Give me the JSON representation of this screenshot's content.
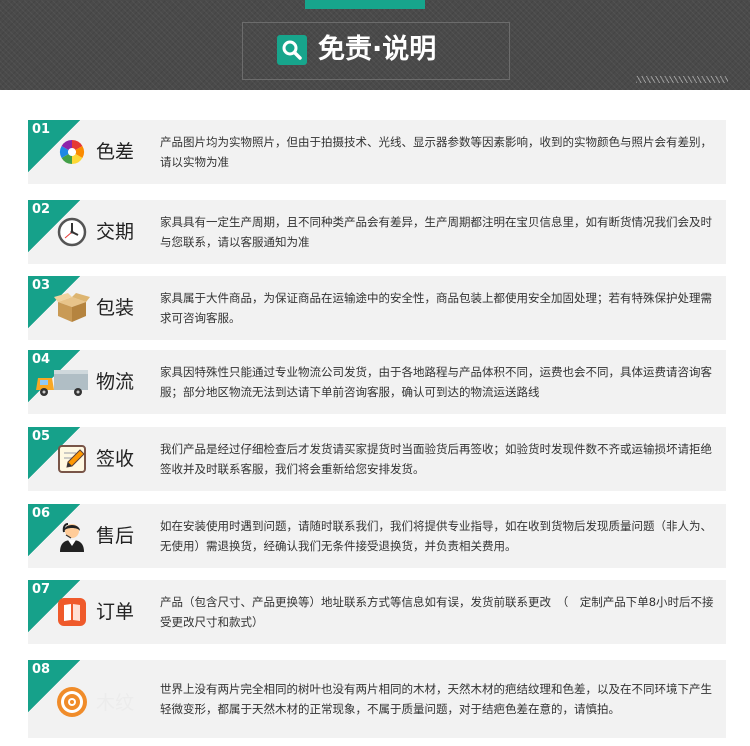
{
  "header": {
    "title": "免责·说明",
    "accent_color": "#17a58c",
    "icon": "search-icon"
  },
  "items": [
    {
      "num": "01",
      "label": "色差",
      "icon": "color-wheel-icon",
      "desc": "产品图片均为实物照片，但由于拍摄技术、光线、显示器参数等因素影响，收到的实物颜色与照片会有差别，请以实物为准"
    },
    {
      "num": "02",
      "label": "交期",
      "icon": "clock-icon",
      "desc": "家具具有一定生产周期，且不同种类产品会有差异，生产周期都注明在宝贝信息里，如有断货情况我们会及时与您联系，请以客服通知为准"
    },
    {
      "num": "03",
      "label": "包装",
      "icon": "package-box-icon",
      "desc": "家具属于大件商品，为保证商品在运输途中的安全性，商品包装上都使用安全加固处理；若有特殊保护处理需求可咨询客服。"
    },
    {
      "num": "04",
      "label": "物流",
      "icon": "delivery-truck-icon",
      "desc": "家具因特殊性只能通过专业物流公司发货，由于各地路程与产品体积不同，运费也会不同，具体运费请咨询客服；部分地区物流无法到达请下单前咨询客服，确认可到达的物流运送路线"
    },
    {
      "num": "05",
      "label": "签收",
      "icon": "sign-pencil-icon",
      "desc": "我们产品是经过仔细检查后才发货请买家提货时当面验货后再签收；如验货时发现件数不齐或运输损坏请拒绝签收并及时联系客服，我们将会重新给您安排发货。"
    },
    {
      "num": "06",
      "label": "售后",
      "icon": "customer-service-icon",
      "desc": "如在安装使用时遇到问题，请随时联系我们，我们将提供专业指导，如在收到货物后发现质量问题（非人为、无使用）需退换货，经确认我们无条件接受退换货，并负责相关费用。"
    },
    {
      "num": "07",
      "label": "订单",
      "icon": "order-book-icon",
      "desc": "产品（包含尺寸、产品更换等）地址联系方式等信息如有误，发货前联系更改　（　定制产品下单8小时后不接受更改尺寸和款式）"
    },
    {
      "num": "08",
      "label": "木纹",
      "icon": "wood-ring-icon",
      "desc": "世界上没有两片完全相同的树叶也没有两片相同的木材，天然木材的疤结纹理和色差，以及在不同环境下产生轻微变形，都属于天然木材的正常现象，不属于质量问题，对于结疤色差在意的，请慎拍。"
    }
  ]
}
